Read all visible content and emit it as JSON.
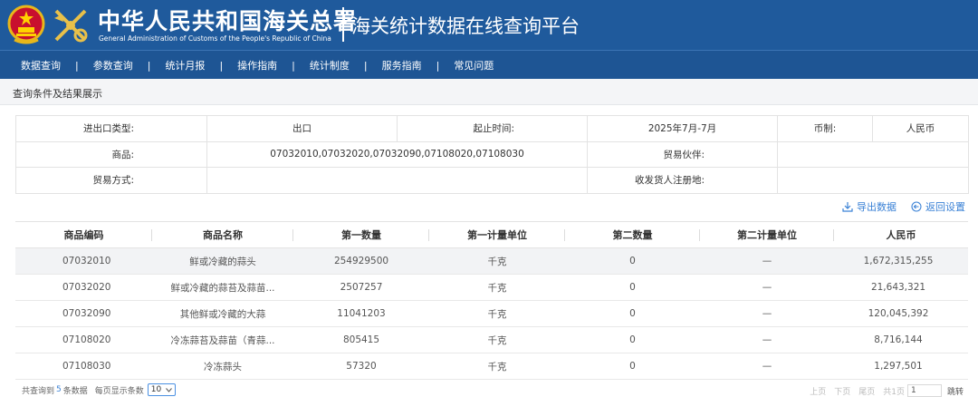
{
  "header": {
    "org_name_cn": "中华人民共和国海关总署",
    "org_name_en": "General Administration of Customs of the People's Republic of China",
    "platform_title": "海关统计数据在线查询平台",
    "brand_color": "#1f5a9c"
  },
  "nav": {
    "items": [
      {
        "label": "数据查询"
      },
      {
        "label": "参数查询"
      },
      {
        "label": "统计月报"
      },
      {
        "label": "操作指南"
      },
      {
        "label": "统计制度"
      },
      {
        "label": "服务指南"
      },
      {
        "label": "常见问题"
      }
    ],
    "separator": "|"
  },
  "breadcrumb": "查询条件及结果展示",
  "conditions": {
    "trade_type_label": "进出口类型:",
    "trade_type_value": "出口",
    "period_label": "起止时间:",
    "period_value": "2025年7月-7月",
    "currency_label": "币制:",
    "currency_value": "人民币",
    "goods_label": "商品:",
    "goods_value": "07032010,07032020,07032090,07108020,07108030",
    "partner_label": "贸易伙伴:",
    "partner_value": "",
    "trade_mode_label": "贸易方式:",
    "trade_mode_value": "",
    "registration_label": "收发货人注册地:",
    "registration_value": ""
  },
  "actions": {
    "export_label": "导出数据",
    "reset_label": "返回设置",
    "link_color": "#3b82d6"
  },
  "results": {
    "columns": [
      "商品编码",
      "商品名称",
      "第一数量",
      "第一计量单位",
      "第二数量",
      "第二计量单位",
      "人民币"
    ],
    "rows": [
      {
        "code": "07032010",
        "name": "鲜或冷藏的蒜头",
        "qty1": "254929500",
        "unit1": "千克",
        "qty2": "0",
        "unit2": "—",
        "rmb": "1,672,315,255"
      },
      {
        "code": "07032020",
        "name": "鲜或冷藏的蒜苔及蒜苗...",
        "qty1": "2507257",
        "unit1": "千克",
        "qty2": "0",
        "unit2": "—",
        "rmb": "21,643,321"
      },
      {
        "code": "07032090",
        "name": "其他鲜或冷藏的大蒜",
        "qty1": "11041203",
        "unit1": "千克",
        "qty2": "0",
        "unit2": "—",
        "rmb": "120,045,392"
      },
      {
        "code": "07108020",
        "name": "冷冻蒜苔及蒜苗（青蒜...",
        "qty1": "805415",
        "unit1": "千克",
        "qty2": "0",
        "unit2": "—",
        "rmb": "8,716,144"
      },
      {
        "code": "07108030",
        "name": "冷冻蒜头",
        "qty1": "57320",
        "unit1": "千克",
        "qty2": "0",
        "unit2": "—",
        "rmb": "1,297,501"
      }
    ]
  },
  "footer": {
    "total_prefix": "共查询到",
    "total_count": "5",
    "total_suffix": "条数据",
    "page_size_label": "每页显示条数",
    "page_size_value": "10",
    "first_page": "上页",
    "next_page": "下页",
    "last_page": "尾页",
    "total_pages": "共1页",
    "current_page": "1",
    "jump_label": "跳转"
  }
}
